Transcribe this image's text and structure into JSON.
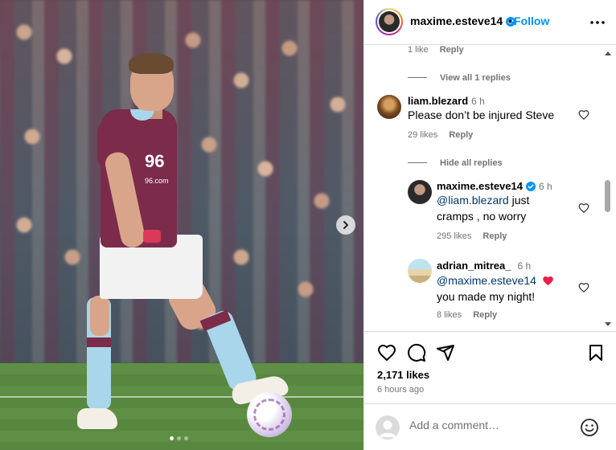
{
  "post": {
    "sponsor_text": "96",
    "sponsor_sub": "96.com",
    "carousel_dots": 3,
    "active_dot": 0
  },
  "header": {
    "username": "maxime.esteve14",
    "dot": "•",
    "follow_label": "Follow"
  },
  "comments": {
    "prev_reply_meta": {
      "likes": "1 like",
      "reply": "Reply"
    },
    "view_replies": "View all 1 replies",
    "c1": {
      "username": "liam.blezard",
      "time": "6 h",
      "text": "Please don’t be injured Steve",
      "likes": "29 likes",
      "reply": "Reply"
    },
    "hide_replies": "Hide all replies",
    "r1": {
      "username": "maxime.esteve14",
      "time": "6 h",
      "mention": "@liam.blezard",
      "text_a": " just",
      "text_b": "cramps , no worry",
      "likes": "295 likes",
      "reply": "Reply"
    },
    "r2": {
      "username": "adrian_mitrea_",
      "time": "6 h",
      "mention": "@maxime.esteve14",
      "text_b": "you made my night!",
      "likes": "8 likes",
      "reply": "Reply"
    }
  },
  "footer": {
    "likes": "2,171 likes",
    "ago": "6 hours ago",
    "comment_placeholder": "Add a comment…"
  },
  "colors": {
    "follow": "#0095f6",
    "mention": "#00376b",
    "muted": "#737373",
    "kit_claret": "#7c2b4a",
    "kit_blue": "#a9d6ea",
    "heart_emoji": "#ed1d4c"
  },
  "icons": [
    "verified-badge-icon",
    "more-options-icon",
    "heart-icon",
    "comment-icon",
    "share-icon",
    "bookmark-icon",
    "emoji-icon",
    "chevron-right-icon"
  ]
}
